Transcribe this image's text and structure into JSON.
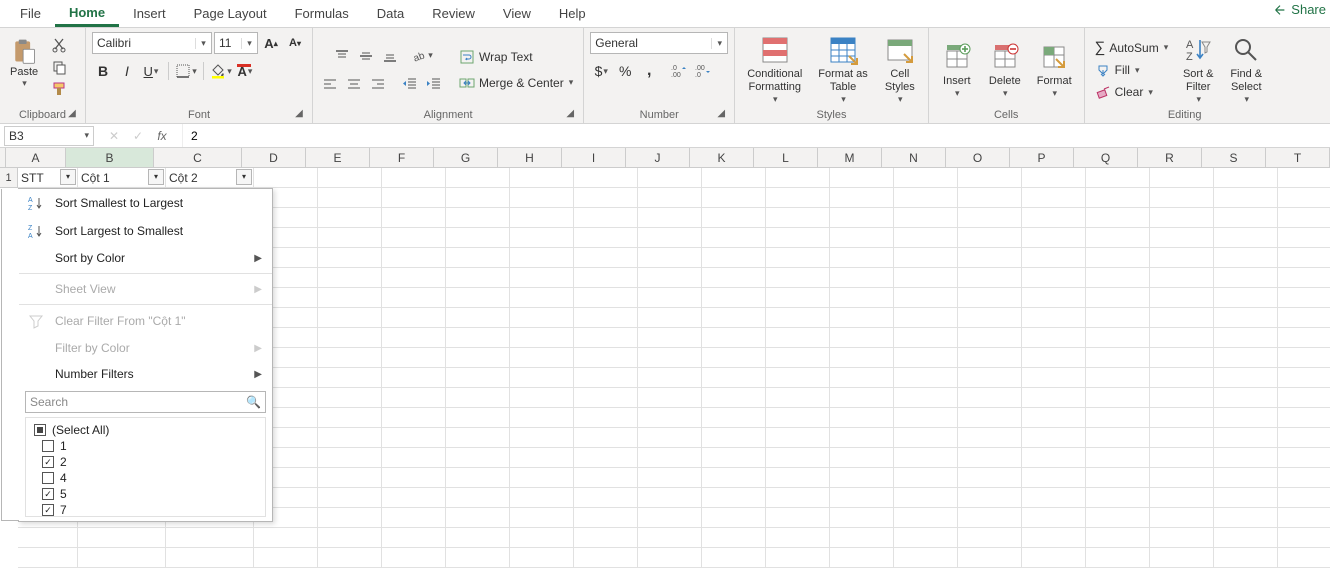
{
  "tabs": {
    "items": [
      "File",
      "Home",
      "Insert",
      "Page Layout",
      "Formulas",
      "Data",
      "Review",
      "View",
      "Help"
    ],
    "active": "Home"
  },
  "share_label": "Share",
  "ribbon": {
    "clipboard": {
      "label": "Clipboard",
      "paste": "Paste"
    },
    "font": {
      "label": "Font",
      "name": "Calibri",
      "size": "11"
    },
    "alignment": {
      "label": "Alignment",
      "wrap": "Wrap Text",
      "merge": "Merge & Center"
    },
    "number": {
      "label": "Number",
      "format": "General"
    },
    "styles": {
      "label": "Styles",
      "conditional": "Conditional\nFormatting",
      "formatas": "Format as\nTable",
      "cell": "Cell\nStyles"
    },
    "cells": {
      "label": "Cells",
      "insert": "Insert",
      "delete": "Delete",
      "format": "Format"
    },
    "editing": {
      "label": "Editing",
      "autosum": "AutoSum",
      "fill": "Fill",
      "clear": "Clear",
      "sortfilter": "Sort &\nFilter",
      "findselect": "Find &\nSelect"
    }
  },
  "namebox": "B3",
  "formula_value": "2",
  "columns": [
    "A",
    "B",
    "C",
    "D",
    "E",
    "F",
    "G",
    "H",
    "I",
    "J",
    "K",
    "L",
    "M",
    "N",
    "O",
    "P",
    "Q",
    "R",
    "S",
    "T"
  ],
  "header_row": {
    "c1": "STT",
    "c2": "Cột 1",
    "c3": "Cột 2"
  },
  "filter_menu": {
    "sort_asc": "Sort Smallest to Largest",
    "sort_desc": "Sort Largest to Smallest",
    "sort_color": "Sort by Color",
    "sheet_view": "Sheet View",
    "clear_filter": "Clear Filter From \"Cột 1\"",
    "filter_color": "Filter by Color",
    "number_filters": "Number Filters",
    "search_placeholder": "Search",
    "select_all": "(Select All)",
    "items": [
      {
        "label": "1",
        "checked": false
      },
      {
        "label": "2",
        "checked": true
      },
      {
        "label": "4",
        "checked": false
      },
      {
        "label": "5",
        "checked": true
      },
      {
        "label": "7",
        "checked": true
      }
    ]
  }
}
